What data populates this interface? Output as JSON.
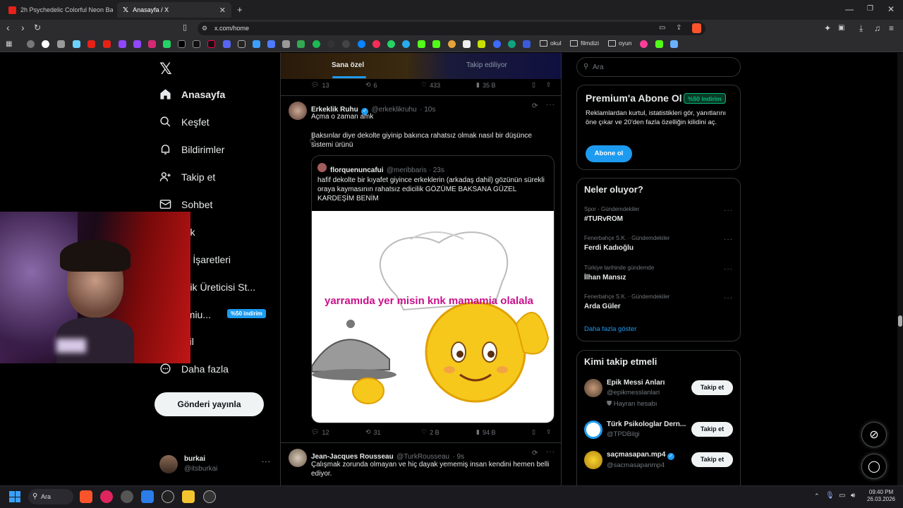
{
  "browser": {
    "tabs": [
      {
        "title": "2h Psychedelic Colorful Neon Backgr"
      },
      {
        "title": "Anasayfa / X"
      }
    ],
    "address": "x.com/home",
    "bookmark_folders": [
      "okul",
      "filmdizi",
      "oyun"
    ]
  },
  "sidebar": {
    "nav": [
      {
        "label": "Anasayfa",
        "icon": "home-icon"
      },
      {
        "label": "Keşfet",
        "icon": "search-icon"
      },
      {
        "label": "Bildirimler",
        "icon": "bell-icon"
      },
      {
        "label": "Takip et",
        "icon": "person-plus-icon"
      },
      {
        "label": "Sohbet",
        "icon": "mail-icon"
      },
      {
        "label": "rok",
        "icon": "grok-icon"
      },
      {
        "label": "er İşaretleri",
        "icon": "bookmark-icon"
      },
      {
        "label": "erik Üreticisi St...",
        "icon": "creator-icon"
      },
      {
        "label": "emiu...",
        "icon": "premium-icon"
      },
      {
        "label": "ofil",
        "icon": "profile-icon"
      },
      {
        "label": "Daha fazla",
        "icon": "more-icon"
      }
    ],
    "premium_badge": "%50 indirim",
    "post_button": "Gönderi yayınla",
    "account": {
      "name": "burkai",
      "handle": "@itsburkai"
    }
  },
  "feed": {
    "tabs": [
      "Sana özel",
      "Takip ediliyor"
    ],
    "prev_stats": {
      "replies": "13",
      "reposts": "6",
      "likes": "433",
      "views": "35 B"
    },
    "tweet1": {
      "name": "Erkeklik Ruhu",
      "handle": "@erkeklikruhu",
      "time": "· 10s",
      "line1": "Açma o zaman amk",
      "line2": "Baksınlar diye dekolte giyinip bakınca rahatsız olmak nasıl bir düşünce sistemi ürünü",
      "quote": {
        "name": "florquenuncafui",
        "handle": "@meribbaris · 23s",
        "text": "hafif dekolte bir kıyafet giyince erkeklerin (arkadaş dahil) gözünün sürekli oraya kaymasının rahatsız edicilik GÖZÜME BAKSANA GÜZEL KARDEŞİM BENİM",
        "image_caption": "yarramıda yer misin knk mamamia olalala"
      },
      "stats": {
        "replies": "12",
        "reposts": "31",
        "likes": "2 B",
        "views": "94 B"
      }
    },
    "tweet2": {
      "name": "Jean-Jacques Rousseau",
      "handle": "@TurkRousseau",
      "time": "· 9s",
      "text": "Çalışmak zorunda olmayan ve hiç dayak yememiş insan kendini hemen belli ediyor."
    }
  },
  "right": {
    "search_placeholder": "Ara",
    "premium": {
      "title": "Premium'a Abone Ol",
      "badge": "%50 indirim",
      "desc": "Reklamlardan kurtul, istatistikleri gör, yanıtlarını öne çıkar ve 20'den fazla özelliğin kilidini aç.",
      "button": "Abone ol"
    },
    "trends_title": "Neler oluyor?",
    "trends": [
      {
        "category": "Spor · Gündemdekiler",
        "name": "#TURvROM"
      },
      {
        "category": "Fenerbahçe S.K. · Gündemdekiler",
        "name": "Ferdi Kadıoğlu"
      },
      {
        "category": "Türkiye tarihinde gündemde",
        "name": "İlhan Mansız"
      },
      {
        "category": "Fenerbahçe S.K. · Gündemdekiler",
        "name": "Arda Güler"
      }
    ],
    "show_more": "Daha fazla göster",
    "who_title": "Kimi takip etmeli",
    "who": [
      {
        "name": "Epik Messi Anları",
        "handle": "@epikmesslanlari",
        "sub": "Hayran hesabı",
        "button": "Takip et"
      },
      {
        "name": "Türk Psikologlar Dern...",
        "handle": "@TPDBilgi",
        "button": "Takip et"
      },
      {
        "name": "saçmasapan.mp4",
        "handle": "@sacmasapanmp4",
        "button": "Takip et"
      }
    ]
  },
  "taskbar": {
    "search": "Ara",
    "time": "09:40 PM",
    "date": "26.03.2026"
  },
  "colors": {
    "accent": "#1d9bf0",
    "bg": "#000000",
    "premium_green": "#00ba7c"
  }
}
